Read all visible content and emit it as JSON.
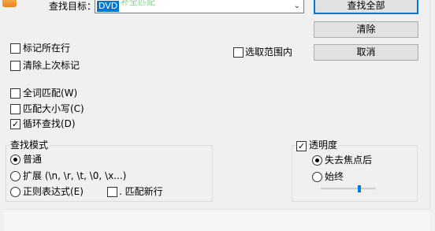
{
  "header": {
    "find_label": "查找目标：",
    "find_value": "DVD",
    "dropdown_icon": "chevron-down-icon"
  },
  "buttons": {
    "find_all": "查找全部",
    "clear": "清除",
    "cancel": "取消"
  },
  "options": {
    "mark_line": "标记所在行",
    "clear_last_marks": "清除上次标记",
    "in_selection": "选取范围内",
    "whole_word": "全词匹配(W)",
    "match_case": "匹配大小写(C)",
    "wrap_around": "循环查找(D)"
  },
  "search_mode": {
    "title": "查找模式",
    "normal": "普通",
    "extended": "扩展 (\\n, \\r, \\t, \\0, \\x...)",
    "regex": "正则表达式(E)",
    "dot_newline": ". 匹配新行"
  },
  "transparency": {
    "title": "透明度",
    "on_lose_focus": "失去焦点后",
    "always": "始终",
    "level": 0.7
  },
  "state": {
    "mark_line": false,
    "clear_last_marks": false,
    "in_selection": false,
    "whole_word": false,
    "match_case": false,
    "wrap_around": true,
    "mode": "normal",
    "dot_newline": false,
    "transparency_enabled": true,
    "transparency_mode": "on_lose_focus"
  },
  "colors": {
    "accent": "#0078d7",
    "app_icon": "#f7a541"
  }
}
